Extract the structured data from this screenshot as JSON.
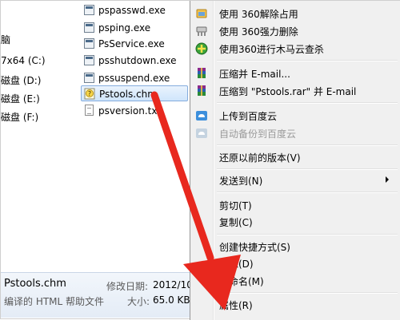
{
  "nav": {
    "items": [
      {
        "label": "脑"
      },
      {
        "label": "7x64 (C:)"
      },
      {
        "label": "磁盘 (D:)"
      },
      {
        "label": "磁盘 (E:)"
      },
      {
        "label": "磁盘 (F:)"
      }
    ]
  },
  "files": [
    {
      "name": "pspasswd.exe",
      "icon": "exe-icon"
    },
    {
      "name": "psping.exe",
      "icon": "exe-icon"
    },
    {
      "name": "PsService.exe",
      "icon": "exe-icon"
    },
    {
      "name": "psshutdown.exe",
      "icon": "exe-icon"
    },
    {
      "name": "pssuspend.exe",
      "icon": "exe-icon"
    },
    {
      "name": "Pstools.chm",
      "icon": "chm-help-icon",
      "selected": true
    },
    {
      "name": "psversion.tx",
      "icon": "text-file-icon"
    }
  ],
  "details": {
    "filename": "Pstools.chm",
    "modified_label": "修改日期:",
    "modified_value": "2012/10",
    "type": "编译的 HTML 帮助文件",
    "size_label": "大小:",
    "size_value": "65.0 KB"
  },
  "context_menu": {
    "items": [
      {
        "label": "使用 360解除占用",
        "icon": "360-unlock-icon"
      },
      {
        "label": "使用 360强力删除",
        "icon": "360-shred-icon"
      },
      {
        "label": "使用360进行木马云查杀",
        "icon": "360-scan-icon"
      },
      {
        "label": "压缩并 E-mail...",
        "icon": "winrar-icon"
      },
      {
        "label": "压缩到 \"Pstools.rar\" 并 E-mail",
        "icon": "winrar-icon"
      },
      {
        "label": "上传到百度云",
        "icon": "baidu-cloud-icon"
      },
      {
        "label": "自动备份到百度云",
        "icon": "baidu-backup-icon",
        "disabled": true
      },
      {
        "label": "还原以前的版本(V)"
      },
      {
        "label": "发送到(N)",
        "submenu": true
      },
      {
        "label": "剪切(T)"
      },
      {
        "label": "复制(C)"
      },
      {
        "label": "创建快捷方式(S)"
      },
      {
        "label": "删除(D)"
      },
      {
        "label": "重命名(M)"
      },
      {
        "label": "属性(R)"
      }
    ]
  },
  "colors": {
    "annotation_arrow": "#e8281e",
    "selection_border": "#84acdd",
    "menu_background": "#f0f0f0"
  }
}
